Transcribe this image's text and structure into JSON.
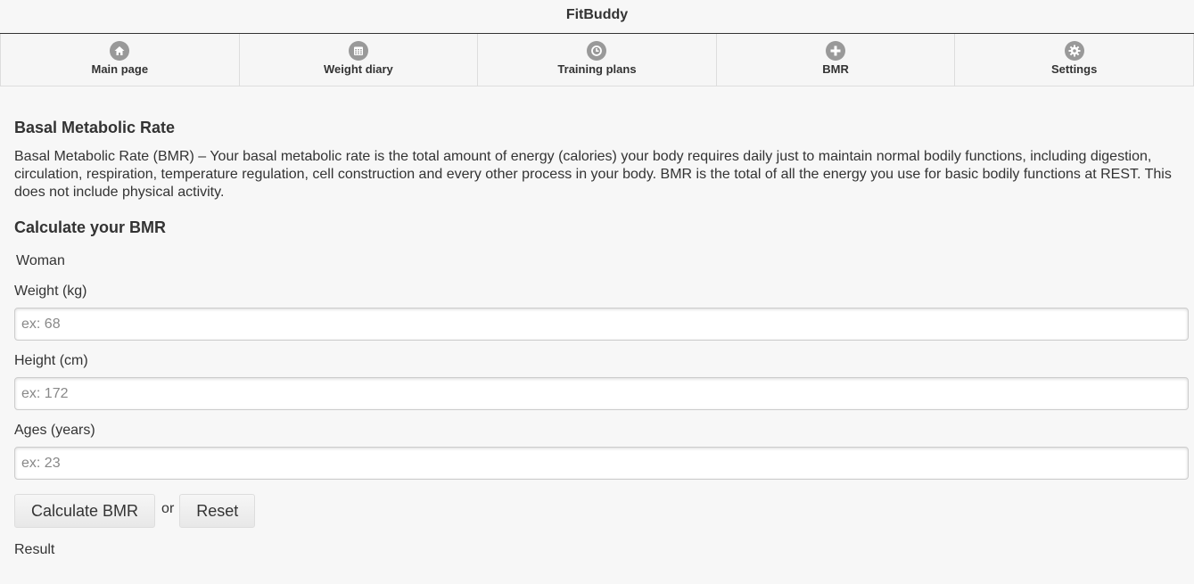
{
  "app": {
    "title": "FitBuddy"
  },
  "nav": {
    "items": [
      {
        "label": "Main page",
        "icon": "home-icon"
      },
      {
        "label": "Weight diary",
        "icon": "calendar-icon"
      },
      {
        "label": "Training plans",
        "icon": "clock-icon"
      },
      {
        "label": "BMR",
        "icon": "plus-icon"
      },
      {
        "label": "Settings",
        "icon": "gear-icon"
      }
    ]
  },
  "main": {
    "title": "Basal Metabolic Rate",
    "description": "Basal Metabolic Rate (BMR) – Your basal metabolic rate is the total amount of energy (calories) your body requires daily just to maintain normal bodily functions, including digestion, circulation, respiration, temperature regulation, cell construction and every other process in your body. BMR is the total of all the energy you use for basic bodily functions at REST. This does not include physical activity.",
    "calc_title": "Calculate your BMR",
    "gender": "Woman",
    "weight": {
      "label": "Weight (kg)",
      "placeholder": "ex: 68",
      "value": ""
    },
    "height": {
      "label": "Height (cm)",
      "placeholder": "ex: 172",
      "value": ""
    },
    "age": {
      "label": "Ages (years)",
      "placeholder": "ex: 23",
      "value": ""
    },
    "calculate_label": "Calculate BMR",
    "or_text": "or",
    "reset_label": "Reset",
    "result_label": "Result"
  },
  "colors": {
    "background": "#f7f7f7",
    "icon_gray": "#999999",
    "text": "#333333"
  }
}
